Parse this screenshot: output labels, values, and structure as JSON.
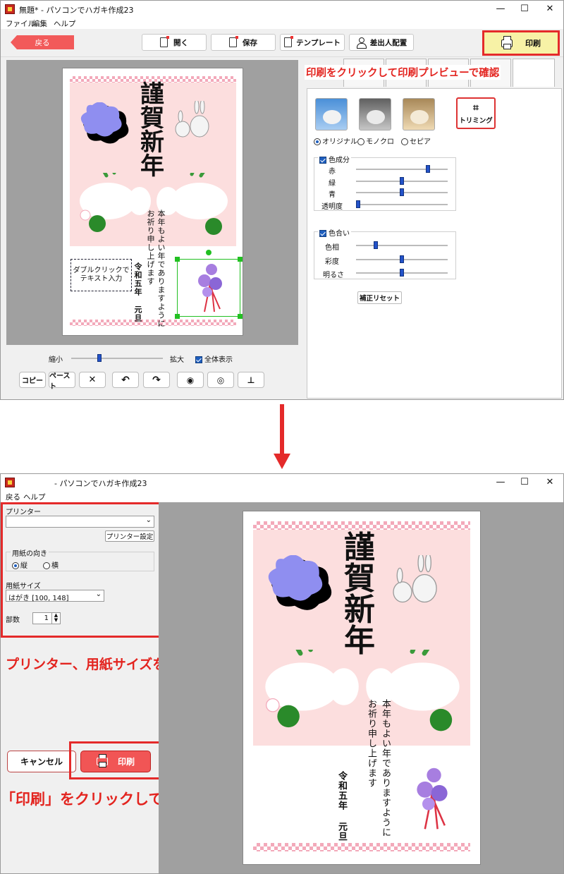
{
  "window1": {
    "title": "無題* - パソコンでハガキ作成23",
    "menu": [
      "ファイル",
      "編集",
      "ヘルプ"
    ],
    "back_label": "戻る",
    "toolbar": {
      "open": "開く",
      "save": "保存",
      "template": "テンプレート",
      "sender": "差出人配置",
      "print": "印刷"
    },
    "annotation": "印刷をクリックして印刷プレビューで確認",
    "card": {
      "title_chars": [
        "謹",
        "賀",
        "新",
        "年"
      ],
      "message": "本年もよい年でありますように",
      "message2": "お祈り申し上げます",
      "year": "令和五年",
      "day": "元旦",
      "placeholder": "ダブルクリックで\nテキスト入力"
    },
    "zoom": {
      "min_label": "縮小",
      "max_label": "拡大",
      "fit_label": "全体表示",
      "level": 0.3
    },
    "bottom_buttons": {
      "copy": "コピー",
      "paste": "ペースト",
      "delete": "✕"
    },
    "color_panel": {
      "modes": [
        "オリジナル",
        "モノクロ",
        "セピア"
      ],
      "trim_label": "トリミング",
      "components_label": "色成分",
      "components": [
        {
          "label": "赤",
          "value": 0.8
        },
        {
          "label": "緑",
          "value": 0.5
        },
        {
          "label": "青",
          "value": 0.5
        },
        {
          "label": "透明度",
          "value": 0.0
        }
      ],
      "hue_label": "色合い",
      "hue": [
        {
          "label": "色相",
          "value": 0.2
        },
        {
          "label": "彩度",
          "value": 0.5
        },
        {
          "label": "明るさ",
          "value": 0.5
        }
      ],
      "reset_label": "補正リセット"
    }
  },
  "arrow": "down-arrow",
  "window2": {
    "title": "- パソコンでハガキ作成23",
    "menu": [
      "戻る",
      "ヘルプ"
    ],
    "printer_label": "プリンター",
    "printer_settings": "プリンター設定",
    "orientation_label": "用紙の向き",
    "orientation_options": [
      "縦",
      "横"
    ],
    "paper_size_label": "用紙サイズ",
    "paper_size_value": "はがき [100, 148]",
    "copies_label": "部数",
    "copies_value": "1",
    "annotation1": "プリンター、用紙サイズを確認",
    "cancel_label": "キャンセル",
    "print_label": "印刷",
    "annotation2": "「印刷」をクリックして印刷"
  },
  "colors": {
    "accent_red": "#e42a2a",
    "back_button": "#f25a5a",
    "card_pink": "#fcdede",
    "checker": "#f3a9ba"
  }
}
